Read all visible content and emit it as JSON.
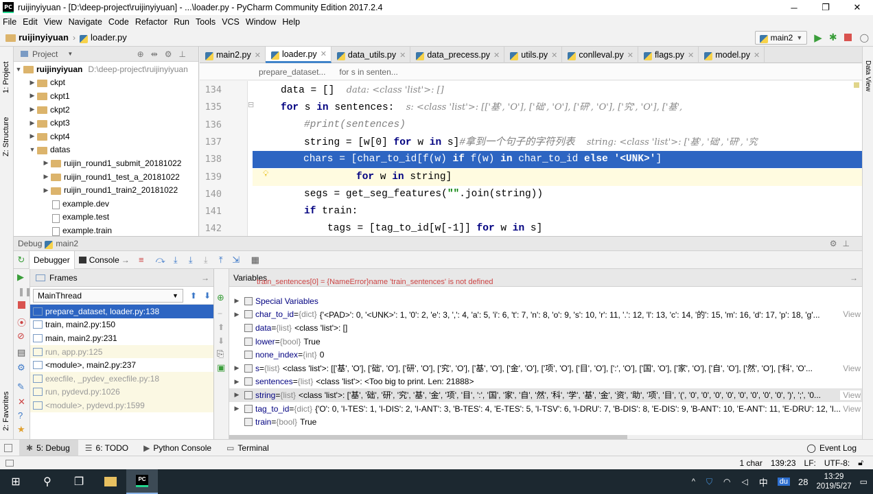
{
  "window": {
    "title": "ruijinyiyuan - [D:\\deep-project\\ruijinyiyuan] - ...\\loader.py - PyCharm Community Edition 2017.2.4",
    "app_icon": "PC",
    "minimize": "─",
    "maximize": "❐",
    "close": "✕"
  },
  "menu": [
    "File",
    "Edit",
    "View",
    "Navigate",
    "Code",
    "Refactor",
    "Run",
    "Tools",
    "VCS",
    "Window",
    "Help"
  ],
  "nav": {
    "project": "ruijinyiyuan",
    "file": "loader.py",
    "run_config": "main2"
  },
  "left_strip": {
    "project": "1: Project",
    "structure": "Z: Structure",
    "favorites": "2: Favorites"
  },
  "right_strip": {
    "data_view": "Data View"
  },
  "project_panel": {
    "header": "Project",
    "root_name": "ruijinyiyuan",
    "root_path": "D:\\deep-project\\ruijinyiyuan",
    "items": [
      {
        "label": "ckpt",
        "kind": "folder",
        "depth": 1
      },
      {
        "label": "ckpt1",
        "kind": "folder",
        "depth": 1
      },
      {
        "label": "ckpt2",
        "kind": "folder",
        "depth": 1
      },
      {
        "label": "ckpt3",
        "kind": "folder",
        "depth": 1
      },
      {
        "label": "ckpt4",
        "kind": "folder",
        "depth": 1
      },
      {
        "label": "datas",
        "kind": "folder-open",
        "depth": 1
      },
      {
        "label": "ruijin_round1_submit_20181022",
        "kind": "folder",
        "depth": 2
      },
      {
        "label": "ruijin_round1_test_a_20181022",
        "kind": "folder",
        "depth": 2
      },
      {
        "label": "ruijin_round1_train2_20181022",
        "kind": "folder",
        "depth": 2
      },
      {
        "label": "example.dev",
        "kind": "file",
        "depth": 2
      },
      {
        "label": "example.test",
        "kind": "file",
        "depth": 2
      },
      {
        "label": "example.train",
        "kind": "file",
        "depth": 2
      }
    ]
  },
  "editor_tabs": [
    {
      "label": "main2.py",
      "active": false
    },
    {
      "label": "loader.py",
      "active": true
    },
    {
      "label": "data_utils.py",
      "active": false
    },
    {
      "label": "data_precess.py",
      "active": false
    },
    {
      "label": "utils.py",
      "active": false
    },
    {
      "label": "conlleval.py",
      "active": false
    },
    {
      "label": "flags.py",
      "active": false
    },
    {
      "label": "model.py",
      "active": false
    }
  ],
  "breadcrumbs": [
    "prepare_dataset...",
    "for s in senten..."
  ],
  "code_lines": [
    {
      "n": "134",
      "indent": 1,
      "parts": [
        {
          "t": "data = []  ",
          "c": ""
        },
        {
          "t": "data: <class 'list'>: []",
          "c": "hint"
        }
      ]
    },
    {
      "n": "135",
      "indent": 1,
      "parts": [
        {
          "t": "for",
          "c": "kw"
        },
        {
          "t": " s ",
          "c": ""
        },
        {
          "t": "in",
          "c": "kw"
        },
        {
          "t": " sentences:  ",
          "c": ""
        },
        {
          "t": "s: <class 'list'>: [['基', 'O'], ['础', 'O'], ['研', 'O'], ['究', 'O'], ['基',",
          "c": "hint"
        }
      ]
    },
    {
      "n": "136",
      "indent": 2,
      "parts": [
        {
          "t": "#print(sentences)",
          "c": "cm"
        }
      ]
    },
    {
      "n": "137",
      "indent": 2,
      "parts": [
        {
          "t": "string = [w[0] ",
          "c": ""
        },
        {
          "t": "for",
          "c": "kw"
        },
        {
          "t": " w ",
          "c": ""
        },
        {
          "t": "in",
          "c": "kw"
        },
        {
          "t": " s]",
          "c": ""
        },
        {
          "t": "#拿到一个句子的字符列表  ",
          "c": "cm"
        },
        {
          "t": "string: <class 'list'>: ['基', '础', '研', '究",
          "c": "hint"
        }
      ]
    },
    {
      "n": "138",
      "indent": 2,
      "hl": true,
      "parts": [
        {
          "t": "chars = [char_to_id[f(w) ",
          "c": ""
        },
        {
          "t": "if",
          "c": "kw"
        },
        {
          "t": " f(w) ",
          "c": ""
        },
        {
          "t": "in",
          "c": "kw"
        },
        {
          "t": " char_to_id ",
          "c": ""
        },
        {
          "t": "else",
          "c": "kw"
        },
        {
          "t": " ",
          "c": ""
        },
        {
          "t": "'<UNK>'",
          "c": "str"
        },
        {
          "t": "]",
          "c": ""
        }
      ]
    },
    {
      "n": "139",
      "indent": 4,
      "cur": true,
      "parts": [
        {
          "t": "for",
          "c": "kw"
        },
        {
          "t": " w ",
          "c": ""
        },
        {
          "t": "in",
          "c": "kw"
        },
        {
          "t": " string]",
          "c": ""
        }
      ]
    },
    {
      "n": "140",
      "indent": 2,
      "parts": [
        {
          "t": "segs = get_seg_features(",
          "c": ""
        },
        {
          "t": "\"\"",
          "c": "str"
        },
        {
          "t": ".join(string))",
          "c": ""
        }
      ]
    },
    {
      "n": "141",
      "indent": 2,
      "parts": [
        {
          "t": "if",
          "c": "kw"
        },
        {
          "t": " train:",
          "c": ""
        }
      ]
    },
    {
      "n": "142",
      "indent": 3,
      "parts": [
        {
          "t": "tags = [tag_to_id[w[-1]] ",
          "c": ""
        },
        {
          "t": "for",
          "c": "kw"
        },
        {
          "t": " w ",
          "c": ""
        },
        {
          "t": "in",
          "c": "kw"
        },
        {
          "t": " s]",
          "c": ""
        }
      ]
    }
  ],
  "debug": {
    "header": "Debug",
    "config": "main2",
    "tab_debugger": "Debugger",
    "tab_console": "Console",
    "frames_title": "Frames",
    "thread": "MainThread",
    "frames": [
      {
        "label": "prepare_dataset, loader.py:138",
        "state": "sel"
      },
      {
        "label": "train, main2.py:150",
        "state": ""
      },
      {
        "label": "main, main2.py:231",
        "state": ""
      },
      {
        "label": "run, app.py:125",
        "state": "lib"
      },
      {
        "label": "<module>, main2.py:237",
        "state": ""
      },
      {
        "label": "execfile, _pydev_execfile.py:18",
        "state": "lib"
      },
      {
        "label": "run, pydevd.py:1026",
        "state": "lib"
      },
      {
        "label": "<module>, pydevd.py:1599",
        "state": "lib"
      }
    ],
    "variables_title": "Variables",
    "error_line": "train_sentences[0] = {NameError}name 'train_sentences' is not defined",
    "variables": [
      {
        "name": "Special Variables",
        "type": "",
        "value": "",
        "expand": true,
        "view": false
      },
      {
        "name": "char_to_id",
        "type": "{dict}",
        "value": "{'<PAD>': 0, '<UNK>': 1, '0': 2, 'e': 3, ',': 4, 'a': 5, 'i': 6, 't': 7, 'n': 8, 'o': 9, 's': 10, 'r': 11, '.': 12, 'l': 13, 'c': 14, '的': 15, 'm': 16, 'd': 17, 'p': 18, 'g'...",
        "expand": true,
        "view": true
      },
      {
        "name": "data",
        "type": "{list}",
        "value": "<class 'list'>: []",
        "expand": false,
        "view": false
      },
      {
        "name": "lower",
        "type": "{bool}",
        "value": "True",
        "expand": false,
        "view": false
      },
      {
        "name": "none_index",
        "type": "{int}",
        "value": "0",
        "expand": false,
        "view": false
      },
      {
        "name": "s",
        "type": "{list}",
        "value": "<class 'list'>: [['基', 'O'], ['础', 'O'], ['研', 'O'], ['究', 'O'], ['基', 'O'], ['金', 'O'], ['项', 'O'], ['目', 'O'], [':', 'O'], ['国', 'O'], ['家', 'O'], ['自', 'O'], ['然', 'O'], ['科', 'O'...",
        "expand": true,
        "view": true
      },
      {
        "name": "sentences",
        "type": "{list}",
        "value": "<class 'list'>: <Too big to print. Len: 21888>",
        "expand": true,
        "view": false
      },
      {
        "name": "string",
        "type": "{list}",
        "value": "<class 'list'>: ['基', '础', '研', '究', '基', '金', '项', '目', ':', '国', '家', '自', '然', '科', '学', '基', '金', '资', '助', '项', '目', '(', '0', '0', '0', '0', '0', '0', '0', '0', ')', ';', '0...",
        "expand": true,
        "view": true,
        "sel": true
      },
      {
        "name": "tag_to_id",
        "type": "{dict}",
        "value": "{'O': 0, 'I-TES': 1, 'I-DIS': 2, 'I-ANT': 3, 'B-TES': 4, 'E-TES': 5, 'I-TSV': 6, 'I-DRU': 7, 'B-DIS': 8, 'E-DIS': 9, 'B-ANT': 10, 'E-ANT': 11, 'E-DRU': 12, 'I...",
        "expand": true,
        "view": true
      },
      {
        "name": "train",
        "type": "{bool}",
        "value": "True",
        "expand": false,
        "view": false
      }
    ],
    "view_label": "View"
  },
  "bottom_tabs": [
    {
      "label": "5: Debug",
      "active": true
    },
    {
      "label": "6: TODO",
      "active": false
    },
    {
      "label": "Python Console",
      "active": false
    },
    {
      "label": "Terminal",
      "active": false
    }
  ],
  "event_log": "Event Log",
  "status": {
    "selection": "1 char",
    "position": "139:23",
    "line_sep": "LF:",
    "encoding": "UTF-8:"
  },
  "taskbar": {
    "ime": "中",
    "baidu": "du",
    "num": "28",
    "time": "13:29",
    "date": "2019/5/27"
  }
}
